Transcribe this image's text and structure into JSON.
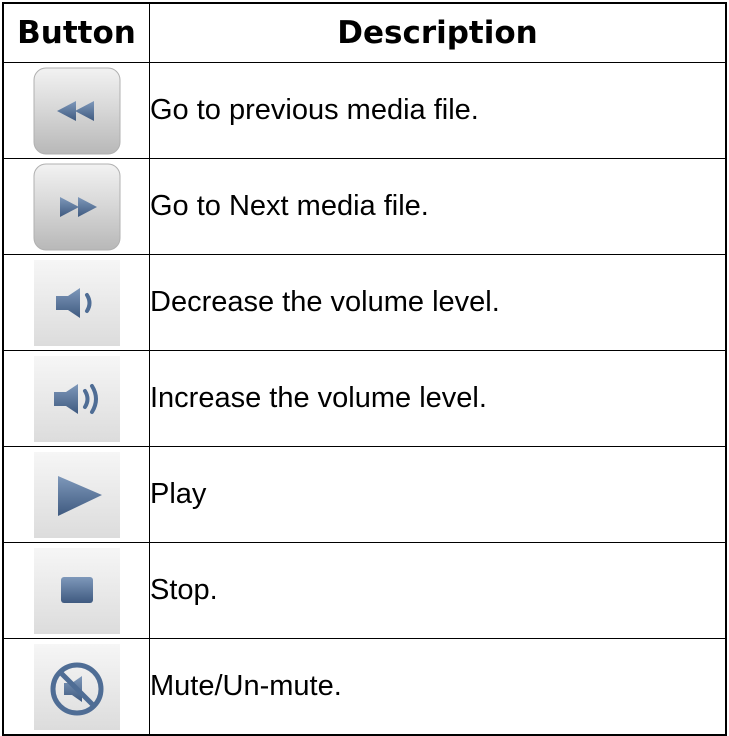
{
  "table": {
    "headers": {
      "button": "Button",
      "description": "Description"
    },
    "rows": [
      {
        "icon": "previous-icon",
        "description": "Go to previous media file."
      },
      {
        "icon": "next-icon",
        "description": "Go to Next media file."
      },
      {
        "icon": "volume-down-icon",
        "description": "Decrease the volume level."
      },
      {
        "icon": "volume-up-icon",
        "description": "Increase the volume level."
      },
      {
        "icon": "play-icon",
        "description": "Play"
      },
      {
        "icon": "stop-icon",
        "description": "Stop."
      },
      {
        "icon": "mute-icon",
        "description": "Mute/Un-mute."
      }
    ]
  },
  "colors": {
    "icon_fill": "#4f6d95",
    "button_bg_top": "#eeeeee",
    "button_bg_bottom": "#bdbdbd"
  }
}
